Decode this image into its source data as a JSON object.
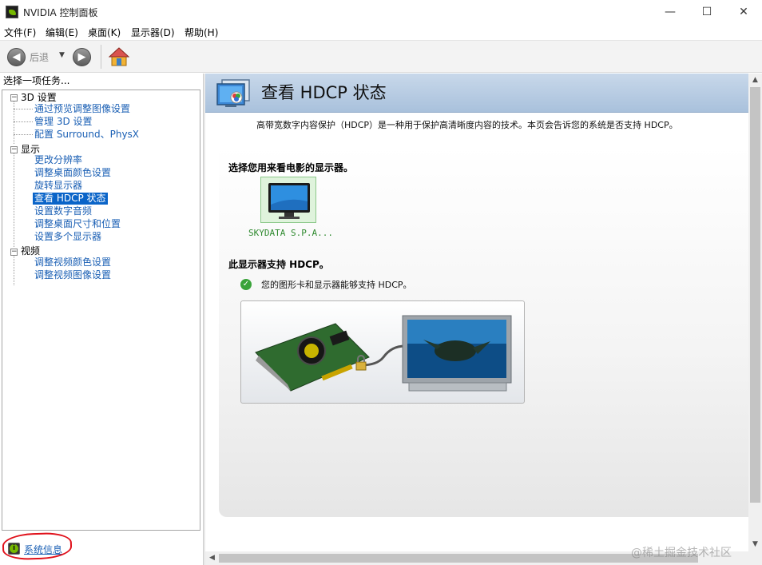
{
  "window": {
    "title": "NVIDIA 控制面板",
    "controls": {
      "minimize": "—",
      "maximize": "☐",
      "close": "✕"
    }
  },
  "menu": [
    "文件(F)",
    "编辑(E)",
    "桌面(K)",
    "显示器(D)",
    "帮助(H)"
  ],
  "toolbar": {
    "back_label": "后退",
    "back_icon": "arrow-left-icon",
    "forward_icon": "arrow-right-icon",
    "home_icon": "home-icon"
  },
  "left_panel": {
    "header": "选择一项任务...",
    "tree": [
      {
        "label": "3D 设置",
        "children": [
          "通过预览调整图像设置",
          "管理 3D 设置",
          "配置 Surround、PhysX"
        ]
      },
      {
        "label": "显示",
        "children": [
          "更改分辨率",
          "调整桌面颜色设置",
          "旋转显示器",
          "查看 HDCP 状态",
          "设置数字音频",
          "调整桌面尺寸和位置",
          "设置多个显示器"
        ]
      },
      {
        "label": "视频",
        "children": [
          "调整视频颜色设置",
          "调整视频图像设置"
        ]
      }
    ],
    "selected": "查看 HDCP 状态",
    "system_info": "系统信息"
  },
  "page": {
    "title": "查看 HDCP 状态",
    "description": "高带宽数字内容保护（HDCP）是一种用于保护高清晰度内容的技术。本页会告诉您的系统是否支持 HDCP。",
    "select_display_label": "选择您用来看电影的显示器。",
    "display_name": "SKYDATA S.P.A...",
    "supports_label": "此显示器支持 HDCP。",
    "supports_detail": "您的图形卡和显示器能够支持 HDCP。"
  },
  "colors": {
    "accent_green": "#76b900",
    "link_blue": "#1a5fb4",
    "selection": "#0a64c8",
    "annotation_red": "#e0101a"
  },
  "watermark": "@稀土掘金技术社区"
}
